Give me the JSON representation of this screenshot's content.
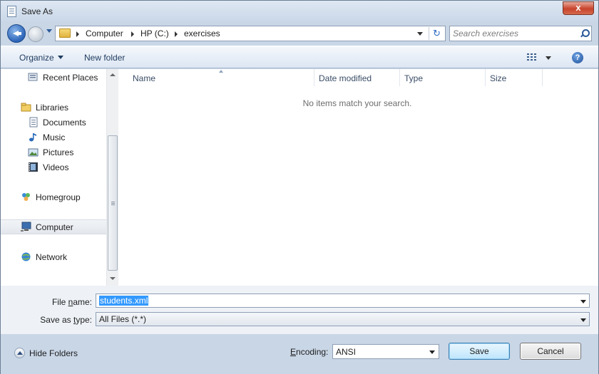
{
  "window": {
    "title": "Save As",
    "close_glyph": "x"
  },
  "nav": {
    "breadcrumbs": [
      "Computer",
      "HP (C:)",
      "exercises"
    ],
    "search_placeholder": "Search exercises"
  },
  "toolbar": {
    "organize_label": "Organize",
    "new_folder_label": "New folder",
    "help_glyph": "?"
  },
  "sidebar": {
    "items": [
      {
        "label": "Recent Places",
        "icon": "recent-places-icon"
      },
      {
        "label": "Libraries",
        "icon": "libraries-icon"
      },
      {
        "label": "Documents",
        "icon": "documents-icon"
      },
      {
        "label": "Music",
        "icon": "music-icon"
      },
      {
        "label": "Pictures",
        "icon": "pictures-icon"
      },
      {
        "label": "Videos",
        "icon": "videos-icon"
      },
      {
        "label": "Homegroup",
        "icon": "homegroup-icon"
      },
      {
        "label": "Computer",
        "icon": "computer-icon",
        "selected": true
      },
      {
        "label": "Network",
        "icon": "network-icon"
      }
    ]
  },
  "filelist": {
    "columns": [
      "Name",
      "Date modified",
      "Type",
      "Size"
    ],
    "empty_message": "No items match your search."
  },
  "form": {
    "filename_label_pre": "File ",
    "filename_label_u": "n",
    "filename_label_post": "ame:",
    "filename_value": "students.xml",
    "savetype_label_pre": "Save as ",
    "savetype_label_u": "t",
    "savetype_label_post": "ype:",
    "savetype_value": "All Files  (*.*)"
  },
  "footer": {
    "hide_folders_label": "Hide Folders",
    "encoding_label_pre": "",
    "encoding_label_u": "E",
    "encoding_label_post": "ncoding:",
    "encoding_value": "ANSI",
    "save_label": "Save",
    "cancel_label": "Cancel"
  },
  "colors": {
    "selection": "#3399ff",
    "chrome": "#c9d6e6",
    "close": "#c7432b"
  }
}
